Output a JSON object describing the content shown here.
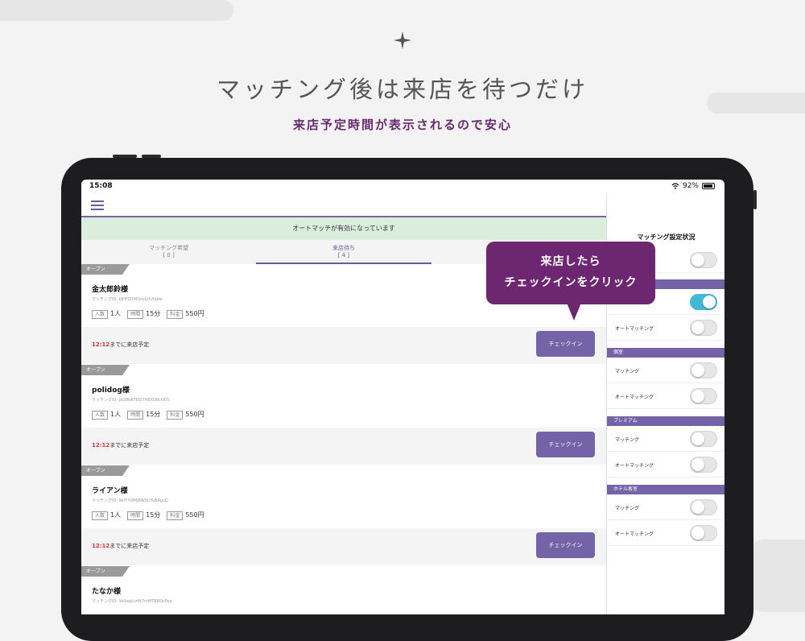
{
  "hero": {
    "headline": "マッチング後は来店を待つだけ",
    "subline": "来店予定時間が表示されるので安心"
  },
  "status": {
    "time": "15:08",
    "battery": "92%"
  },
  "banner": "オートマッチが有効になっています",
  "tabs": [
    {
      "label": "マッチング希望",
      "count": "[ 0 ]"
    },
    {
      "label": "来店待ち",
      "count": "[ 4 ]"
    },
    {
      "label": "",
      "count": ""
    }
  ],
  "callout": {
    "line1": "来店したら",
    "line2": "チェックインをクリック"
  },
  "labels": {
    "people": "人数",
    "time": "時間",
    "fee": "料金",
    "open": "オープン",
    "checkin": "チェックイン"
  },
  "cards": [
    {
      "name": "金太郎鈴様",
      "mid": "マッチングID: kJHFIZU9UxsLOUfqbw",
      "people": "1人",
      "time": "15分",
      "fee": "550円",
      "eta_time": "12:12",
      "eta_text": "までに来店予定"
    },
    {
      "name": "polidog様",
      "mid": "マッチングID: pfZ8b87I007HEXD8cO03",
      "people": "1人",
      "time": "15分",
      "fee": "550円",
      "eta_time": "12:12",
      "eta_text": "までに来店予定"
    },
    {
      "name": "ライアン様",
      "mid": "マッチングID: 9xrf7t9MJ8W3UYu8AgyD",
      "people": "1人",
      "time": "15分",
      "fee": "550円",
      "eta_time": "12:12",
      "eta_text": "までに来店予定"
    },
    {
      "name": "たなか様",
      "mid": "マッチングID: XeSwpLvtN7mMTBRDcPeo",
      "people": "",
      "time": "",
      "fee": "",
      "eta_time": "",
      "eta_text": ""
    }
  ],
  "side": {
    "title": "マッチング設定状況",
    "sections": [
      {
        "name": "",
        "rows": [
          {
            "label": "",
            "on": false
          }
        ]
      },
      {
        "name": "",
        "rows": [
          {
            "label": "",
            "on": true
          },
          {
            "label": "オートマッチング",
            "on": false
          }
        ]
      },
      {
        "name": "個室",
        "rows": [
          {
            "label": "マッチング",
            "on": false
          },
          {
            "label": "オートマッチング",
            "on": false
          }
        ]
      },
      {
        "name": "プレミアム",
        "rows": [
          {
            "label": "マッチング",
            "on": false
          },
          {
            "label": "オートマッチング",
            "on": false
          }
        ]
      },
      {
        "name": "ホテル客室",
        "rows": [
          {
            "label": "マッチング",
            "on": false
          },
          {
            "label": "オートマッチング",
            "on": false
          }
        ]
      }
    ]
  }
}
